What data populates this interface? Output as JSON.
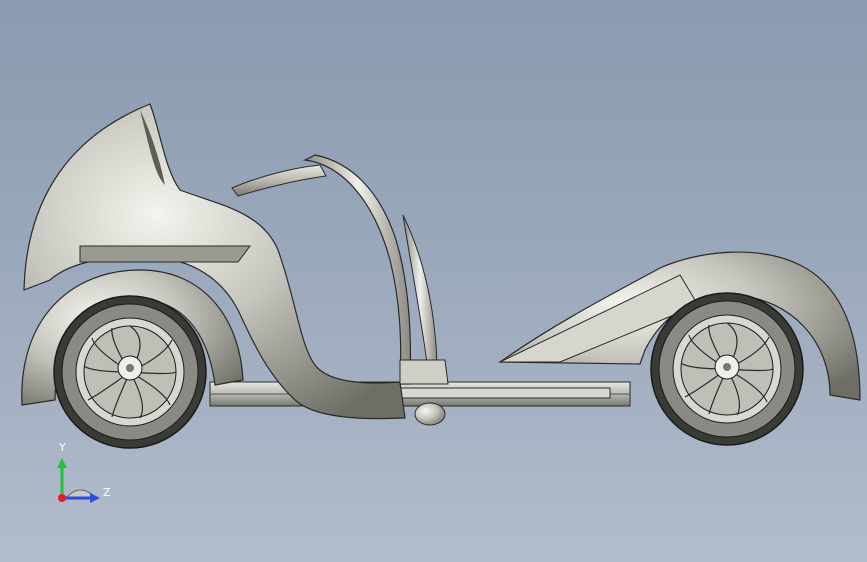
{
  "viewport": {
    "background_top": "#8b9ab0",
    "background_bottom": "#b2bccc"
  },
  "model": {
    "part_color": "#c8c8c0",
    "shade_color": "#7b7b73",
    "highlight_color": "#f2f2ec",
    "edge_color": "#2a2a2a"
  },
  "triad": {
    "y_axis_label": "Y",
    "z_axis_label": "Z",
    "y_color": "#22c33a",
    "z_color": "#2f4be0",
    "origin_color": "#e02020"
  }
}
